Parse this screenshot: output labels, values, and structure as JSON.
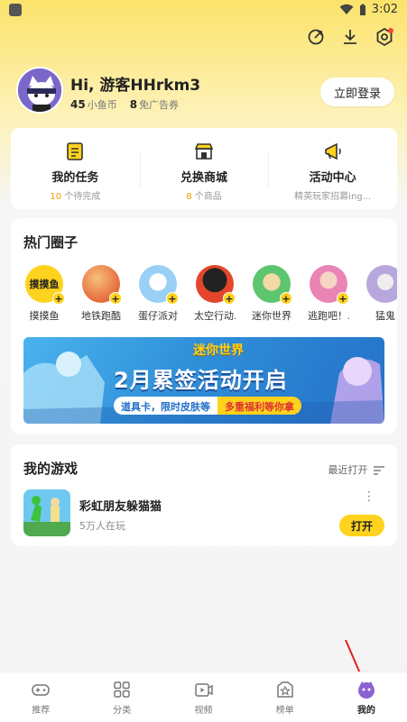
{
  "status": {
    "time": "3:02"
  },
  "profile": {
    "greeting": "Hi, 游客HHrkm3",
    "coins_value": "45",
    "coins_label": "小鱼币",
    "coupons_value": "8",
    "coupons_label": "免广告券",
    "login_label": "立即登录"
  },
  "quick": [
    {
      "title": "我的任务",
      "num": "10",
      "sub": "个待完成",
      "icon": "task-icon"
    },
    {
      "title": "兑换商城",
      "num": "8",
      "sub": "个商品",
      "icon": "shop-icon"
    },
    {
      "title": "活动中心",
      "num": "",
      "sub": "精英玩家招募ing...",
      "icon": "megaphone-icon"
    }
  ],
  "hot": {
    "title": "热门圈子",
    "circles": [
      {
        "name": "摸摸鱼",
        "logo": "摸摸鱼",
        "color": "#ffd21d"
      },
      {
        "name": "地铁跑酷",
        "color": "#e66a3c"
      },
      {
        "name": "蛋仔派对",
        "color": "#9ad0f5"
      },
      {
        "name": "太空行动...",
        "color": "#e3462a"
      },
      {
        "name": "迷你世界",
        "color": "#5cc56e"
      },
      {
        "name": "逃跑吧！...",
        "color": "#e984b5"
      },
      {
        "name": "猛鬼",
        "color": "#b7a7dd"
      }
    ],
    "banner": {
      "logo": "迷你世界",
      "title": "2月累签活动开启",
      "sub1": "道具卡，限时皮肤等",
      "sub2": "多重福利等你拿"
    }
  },
  "games": {
    "title": "我的游戏",
    "recent_label": "最近打开",
    "items": [
      {
        "name": "彩虹朋友躲猫猫",
        "players": "5万人在玩",
        "open_label": "打开"
      }
    ]
  },
  "tabs": [
    {
      "label": "推荐",
      "icon": "gamepad-icon"
    },
    {
      "label": "分类",
      "icon": "grid-icon"
    },
    {
      "label": "视频",
      "icon": "video-icon"
    },
    {
      "label": "榜单",
      "icon": "rank-icon"
    },
    {
      "label": "我的",
      "icon": "profile-icon",
      "active": true
    }
  ]
}
